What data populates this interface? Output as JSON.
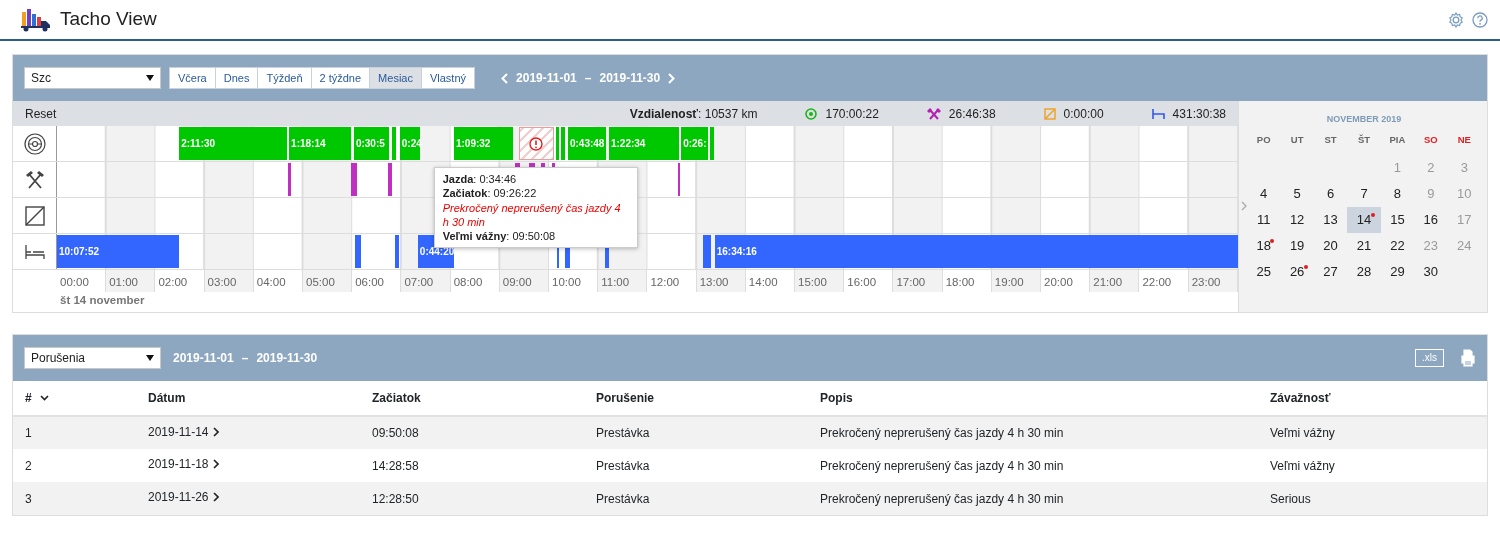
{
  "app": {
    "title": "Tacho View"
  },
  "toolbar": {
    "driver_select": {
      "value": "Szc"
    },
    "periods": [
      {
        "label": "Včera",
        "selected": false
      },
      {
        "label": "Dnes",
        "selected": false
      },
      {
        "label": "Týždeň",
        "selected": false
      },
      {
        "label": "2 týždne",
        "selected": false
      },
      {
        "label": "Mesiac",
        "selected": true
      },
      {
        "label": "Vlastný",
        "selected": false
      }
    ],
    "range": {
      "from": "2019-11-01",
      "separator": "–",
      "to": "2019-11-30"
    }
  },
  "summary": {
    "reset": "Reset",
    "distance": "**Vzdialenosť**: 10537 km",
    "stats": [
      {
        "kind": "driving",
        "value": "170:00:22"
      },
      {
        "kind": "work",
        "value": "26:46:38"
      },
      {
        "kind": "availability",
        "value": "0:00:00"
      },
      {
        "kind": "rest",
        "value": "431:30:38"
      }
    ]
  },
  "timeline": {
    "rows": [
      {
        "kind": "driving",
        "segments": [
          {
            "kind": "bar",
            "label": "2:11:30"
          },
          {
            "kind": "bar",
            "label": "1:18:14"
          },
          {
            "kind": "bar",
            "label": "0:30:5"
          },
          {
            "kind": "mark"
          },
          {
            "kind": "bar",
            "label": "0:24"
          },
          {
            "kind": "bar",
            "label": "1:09:32"
          },
          {
            "kind": "violation"
          },
          {
            "kind": "mark"
          },
          {
            "kind": "mark"
          },
          {
            "kind": "bar",
            "label": "0:43:48"
          },
          {
            "kind": "bar",
            "label": "1:22:34"
          },
          {
            "kind": "bar",
            "label": "0:26:"
          },
          {
            "kind": "mark"
          }
        ]
      },
      {
        "kind": "work",
        "segments": [
          {
            "kind": "mark"
          },
          {
            "kind": "mark"
          },
          {
            "kind": "mark"
          },
          {
            "kind": "mark"
          },
          {
            "kind": "mark"
          },
          {
            "kind": "mark"
          },
          {
            "kind": "mark"
          },
          {
            "kind": "mark"
          }
        ]
      },
      {
        "kind": "availability"
      },
      {
        "kind": "rest",
        "segments": [
          {
            "kind": "bar",
            "label": "10:07:52"
          },
          {
            "kind": "mark"
          },
          {
            "kind": "mark"
          },
          {
            "kind": "bar",
            "label": "0:44:20"
          },
          {
            "kind": "mark"
          },
          {
            "kind": "mark"
          },
          {
            "kind": "mark"
          },
          {
            "kind": "mark"
          },
          {
            "kind": "bar",
            "label": "16:34:16"
          }
        ]
      }
    ],
    "hours": [
      "00:00",
      "01:00",
      "02:00",
      "03:00",
      "04:00",
      "05:00",
      "06:00",
      "07:00",
      "08:00",
      "09:00",
      "10:00",
      "11:00",
      "12:00",
      "13:00",
      "14:00",
      "15:00",
      "16:00",
      "17:00",
      "18:00",
      "19:00",
      "20:00",
      "21:00",
      "22:00",
      "23:00"
    ],
    "day_label": "št 14 november",
    "tooltip": {
      "lines": [
        {
          "kind": "info",
          "text": "**Jazda**: 0:34:46"
        },
        {
          "kind": "info",
          "text": "**Začiatok**: 09:26:22"
        },
        {
          "kind": "warning",
          "text": "Prekročený neprerušený čas jazdy 4 h 30 min"
        },
        {
          "kind": "info",
          "text": "**Veľmi vážny**: 09:50:08"
        }
      ]
    }
  },
  "calendar": {
    "title": "NOVEMBER 2019",
    "weekdays": [
      {
        "label": "PO",
        "weekend": false
      },
      {
        "label": "UT",
        "weekend": false
      },
      {
        "label": "ST",
        "weekend": false
      },
      {
        "label": "ŠT",
        "weekend": false
      },
      {
        "label": "PIA",
        "weekend": false
      },
      {
        "label": "SO",
        "weekend": true
      },
      {
        "label": "NE",
        "weekend": true
      }
    ],
    "weeks": [
      [
        {
          "day": "1",
          "muted": true,
          "selected": false,
          "flag": false
        },
        {
          "day": "2",
          "muted": true,
          "selected": false,
          "flag": false
        },
        {
          "day": "3",
          "muted": true,
          "selected": false,
          "flag": false
        }
      ],
      [
        {
          "day": "4",
          "muted": false,
          "selected": false,
          "flag": false
        },
        {
          "day": "5",
          "muted": false,
          "selected": false,
          "flag": false
        },
        {
          "day": "6",
          "muted": false,
          "selected": false,
          "flag": false
        },
        {
          "day": "7",
          "muted": false,
          "selected": false,
          "flag": false
        },
        {
          "day": "8",
          "muted": false,
          "selected": false,
          "flag": false
        },
        {
          "day": "9",
          "muted": true,
          "selected": false,
          "flag": false
        },
        {
          "day": "10",
          "muted": true,
          "selected": false,
          "flag": false
        }
      ],
      [
        {
          "day": "11",
          "muted": false,
          "selected": false,
          "flag": false
        },
        {
          "day": "12",
          "muted": false,
          "selected": false,
          "flag": false
        },
        {
          "day": "13",
          "muted": false,
          "selected": false,
          "flag": false
        },
        {
          "day": "14",
          "muted": false,
          "selected": true,
          "flag": true
        },
        {
          "day": "15",
          "muted": false,
          "selected": false,
          "flag": false
        },
        {
          "day": "16",
          "muted": false,
          "selected": false,
          "flag": false
        },
        {
          "day": "17",
          "muted": true,
          "selected": false,
          "flag": false
        }
      ],
      [
        {
          "day": "18",
          "muted": false,
          "selected": false,
          "flag": true
        },
        {
          "day": "19",
          "muted": false,
          "selected": false,
          "flag": false
        },
        {
          "day": "20",
          "muted": false,
          "selected": false,
          "flag": false
        },
        {
          "day": "21",
          "muted": false,
          "selected": false,
          "flag": false
        },
        {
          "day": "22",
          "muted": false,
          "selected": false,
          "flag": false
        },
        {
          "day": "23",
          "muted": true,
          "selected": false,
          "flag": false
        },
        {
          "day": "24",
          "muted": true,
          "selected": false,
          "flag": false
        }
      ],
      [
        {
          "day": "25",
          "muted": false,
          "selected": false,
          "flag": false
        },
        {
          "day": "26",
          "muted": false,
          "selected": false,
          "flag": true
        },
        {
          "day": "27",
          "muted": false,
          "selected": false,
          "flag": false
        },
        {
          "day": "28",
          "muted": false,
          "selected": false,
          "flag": false
        },
        {
          "day": "29",
          "muted": false,
          "selected": false,
          "flag": false
        },
        {
          "day": "30",
          "muted": false,
          "selected": false,
          "flag": false
        }
      ]
    ]
  },
  "violations": {
    "report_select": {
      "value": "Porušenia"
    },
    "range": {
      "from": "2019-11-01",
      "separator": "–",
      "to": "2019-11-30"
    },
    "export_button": ".xls",
    "table": {
      "columns": [
        "#",
        "Dátum",
        "Začiatok",
        "Porušenie",
        "Popis",
        "Závažnosť"
      ],
      "rows": [
        [
          "1",
          "2019-11-14",
          "09:50:08",
          "Prestávka",
          "Prekročený neprerušený čas jazdy 4 h 30 min",
          "Veľmi vážny"
        ],
        [
          "2",
          "2019-11-18",
          "14:28:58",
          "Prestávka",
          "Prekročený neprerušený čas jazdy 4 h 30 min",
          "Veľmi vážny"
        ],
        [
          "3",
          "2019-11-26",
          "12:28:50",
          "Prestávka",
          "Prekročený neprerušený čas jazdy 4 h 30 min",
          "Serious"
        ]
      ]
    }
  }
}
